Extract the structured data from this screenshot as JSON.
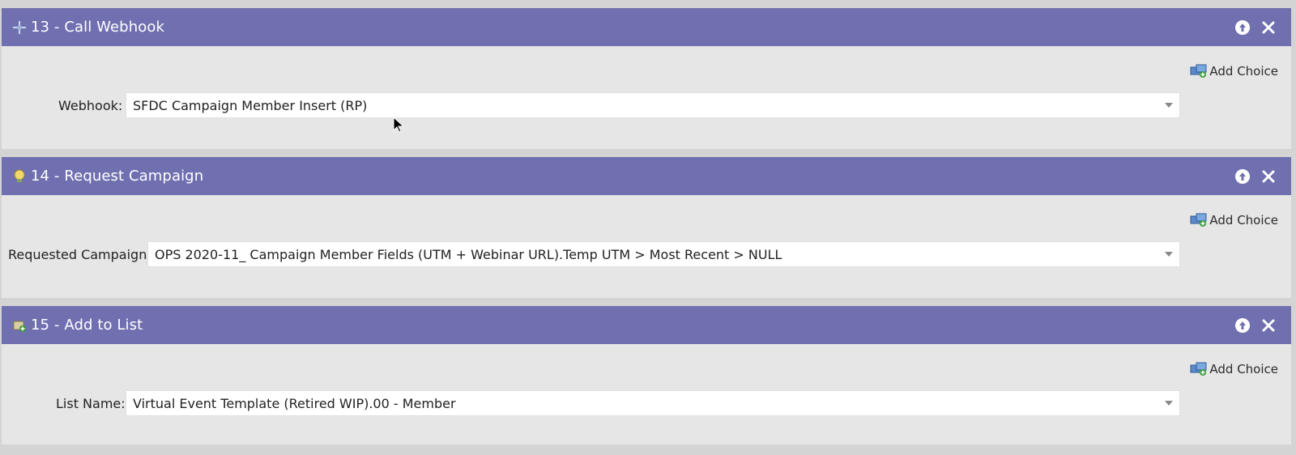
{
  "steps": [
    {
      "title": "13 - Call Webhook",
      "icon": "webhook-icon",
      "field_label": "Webhook:",
      "field_value": "SFDC Campaign Member Insert (RP)",
      "add_choice": "Add Choice"
    },
    {
      "title": "14 - Request Campaign",
      "icon": "request-campaign-icon",
      "field_label": "Requested Campaign:",
      "field_value": "OPS 2020-11_ Campaign Member Fields (UTM + Webinar URL).Temp UTM > Most Recent > NULL",
      "add_choice": "Add Choice"
    },
    {
      "title": "15 - Add to List",
      "icon": "add-to-list-icon",
      "field_label": "List Name:",
      "field_value": "Virtual Event Template (Retired WIP).00 - Member",
      "add_choice": "Add Choice"
    }
  ],
  "colors": {
    "header": "#7070b0",
    "panel": "#e6e6e6",
    "background": "#d4d4d4"
  }
}
